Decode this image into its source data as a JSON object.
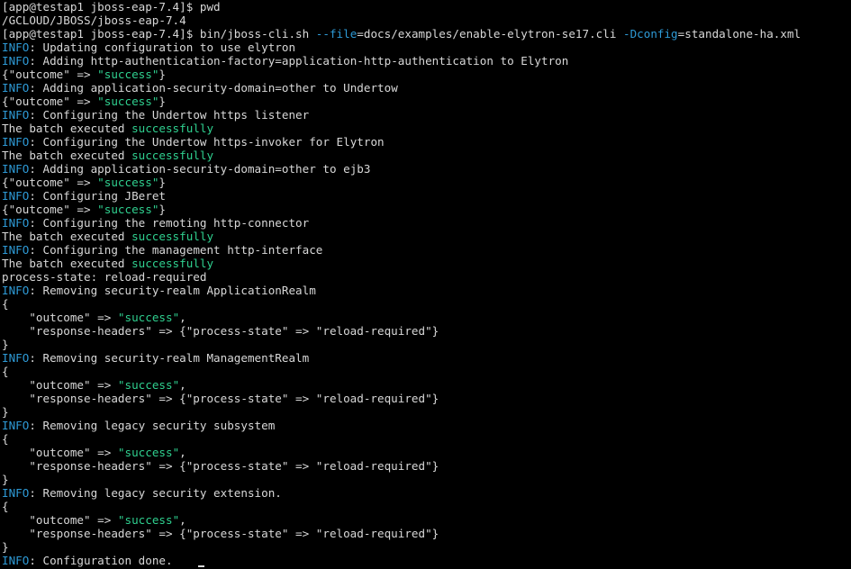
{
  "terminal": {
    "colors": {
      "background": "#000000",
      "default": "#d8d8d8",
      "info": "#2e9ad6",
      "success": "#2fd08f",
      "option": "#2e9ad6"
    },
    "lines": [
      [
        {
          "t": "[app@testap1 jboss-eap-7.4]$ pwd",
          "c": "default"
        }
      ],
      [
        {
          "t": "/GCLOUD/JBOSS/jboss-eap-7.4",
          "c": "default"
        }
      ],
      [
        {
          "t": "[app@testap1 jboss-eap-7.4]$ bin/jboss-cli.sh ",
          "c": "default"
        },
        {
          "t": "--file",
          "c": "option"
        },
        {
          "t": "=docs/examples/enable-elytron-se17.cli ",
          "c": "default"
        },
        {
          "t": "-Dconfig",
          "c": "option"
        },
        {
          "t": "=standalone-ha.xml",
          "c": "default"
        }
      ],
      [
        {
          "t": "INFO",
          "c": "info"
        },
        {
          "t": ": Updating configuration to use elytron",
          "c": "default"
        }
      ],
      [
        {
          "t": "INFO",
          "c": "info"
        },
        {
          "t": ": Adding http-authentication-factory=application-http-authentication to Elytron",
          "c": "default"
        }
      ],
      [
        {
          "t": "{\"outcome\" => ",
          "c": "default"
        },
        {
          "t": "\"success\"",
          "c": "success"
        },
        {
          "t": "}",
          "c": "default"
        }
      ],
      [
        {
          "t": "INFO",
          "c": "info"
        },
        {
          "t": ": Adding application-security-domain=other to Undertow",
          "c": "default"
        }
      ],
      [
        {
          "t": "{\"outcome\" => ",
          "c": "default"
        },
        {
          "t": "\"success\"",
          "c": "success"
        },
        {
          "t": "}",
          "c": "default"
        }
      ],
      [
        {
          "t": "INFO",
          "c": "info"
        },
        {
          "t": ": Configuring the Undertow https listener",
          "c": "default"
        }
      ],
      [
        {
          "t": "The batch executed ",
          "c": "default"
        },
        {
          "t": "successfully",
          "c": "success"
        }
      ],
      [
        {
          "t": "INFO",
          "c": "info"
        },
        {
          "t": ": Configuring the Undertow https-invoker for Elytron",
          "c": "default"
        }
      ],
      [
        {
          "t": "The batch executed ",
          "c": "default"
        },
        {
          "t": "successfully",
          "c": "success"
        }
      ],
      [
        {
          "t": "INFO",
          "c": "info"
        },
        {
          "t": ": Adding application-security-domain=other to ejb3",
          "c": "default"
        }
      ],
      [
        {
          "t": "{\"outcome\" => ",
          "c": "default"
        },
        {
          "t": "\"success\"",
          "c": "success"
        },
        {
          "t": "}",
          "c": "default"
        }
      ],
      [
        {
          "t": "INFO",
          "c": "info"
        },
        {
          "t": ": Configuring JBeret",
          "c": "default"
        }
      ],
      [
        {
          "t": "{\"outcome\" => ",
          "c": "default"
        },
        {
          "t": "\"success\"",
          "c": "success"
        },
        {
          "t": "}",
          "c": "default"
        }
      ],
      [
        {
          "t": "INFO",
          "c": "info"
        },
        {
          "t": ": Configuring the remoting http-connector",
          "c": "default"
        }
      ],
      [
        {
          "t": "The batch executed ",
          "c": "default"
        },
        {
          "t": "successfully",
          "c": "success"
        }
      ],
      [
        {
          "t": "INFO",
          "c": "info"
        },
        {
          "t": ": Configuring the management http-interface",
          "c": "default"
        }
      ],
      [
        {
          "t": "The batch executed ",
          "c": "default"
        },
        {
          "t": "successfully",
          "c": "success"
        }
      ],
      [
        {
          "t": "process-state: reload-required",
          "c": "default"
        }
      ],
      [
        {
          "t": "INFO",
          "c": "info"
        },
        {
          "t": ": Removing security-realm ApplicationRealm",
          "c": "default"
        }
      ],
      [
        {
          "t": "{",
          "c": "default"
        }
      ],
      [
        {
          "t": "    \"outcome\" => ",
          "c": "default"
        },
        {
          "t": "\"success\"",
          "c": "success"
        },
        {
          "t": ",",
          "c": "default"
        }
      ],
      [
        {
          "t": "    \"response-headers\" => {\"process-state\" => \"reload-required\"}",
          "c": "default"
        }
      ],
      [
        {
          "t": "}",
          "c": "default"
        }
      ],
      [
        {
          "t": "INFO",
          "c": "info"
        },
        {
          "t": ": Removing security-realm ManagementRealm",
          "c": "default"
        }
      ],
      [
        {
          "t": "{",
          "c": "default"
        }
      ],
      [
        {
          "t": "    \"outcome\" => ",
          "c": "default"
        },
        {
          "t": "\"success\"",
          "c": "success"
        },
        {
          "t": ",",
          "c": "default"
        }
      ],
      [
        {
          "t": "    \"response-headers\" => {\"process-state\" => \"reload-required\"}",
          "c": "default"
        }
      ],
      [
        {
          "t": "}",
          "c": "default"
        }
      ],
      [
        {
          "t": "INFO",
          "c": "info"
        },
        {
          "t": ": Removing legacy security subsystem",
          "c": "default"
        }
      ],
      [
        {
          "t": "{",
          "c": "default"
        }
      ],
      [
        {
          "t": "    \"outcome\" => ",
          "c": "default"
        },
        {
          "t": "\"success\"",
          "c": "success"
        },
        {
          "t": ",",
          "c": "default"
        }
      ],
      [
        {
          "t": "    \"response-headers\" => {\"process-state\" => \"reload-required\"}",
          "c": "default"
        }
      ],
      [
        {
          "t": "}",
          "c": "default"
        }
      ],
      [
        {
          "t": "INFO",
          "c": "info"
        },
        {
          "t": ": Removing legacy security extension.",
          "c": "default"
        }
      ],
      [
        {
          "t": "{",
          "c": "default"
        }
      ],
      [
        {
          "t": "    \"outcome\" => ",
          "c": "default"
        },
        {
          "t": "\"success\"",
          "c": "success"
        },
        {
          "t": ",",
          "c": "default"
        }
      ],
      [
        {
          "t": "    \"response-headers\" => {\"process-state\" => \"reload-required\"}",
          "c": "default"
        }
      ],
      [
        {
          "t": "}",
          "c": "default"
        }
      ],
      [
        {
          "t": "INFO",
          "c": "info"
        },
        {
          "t": ": Configuration done.",
          "c": "default"
        }
      ]
    ]
  }
}
